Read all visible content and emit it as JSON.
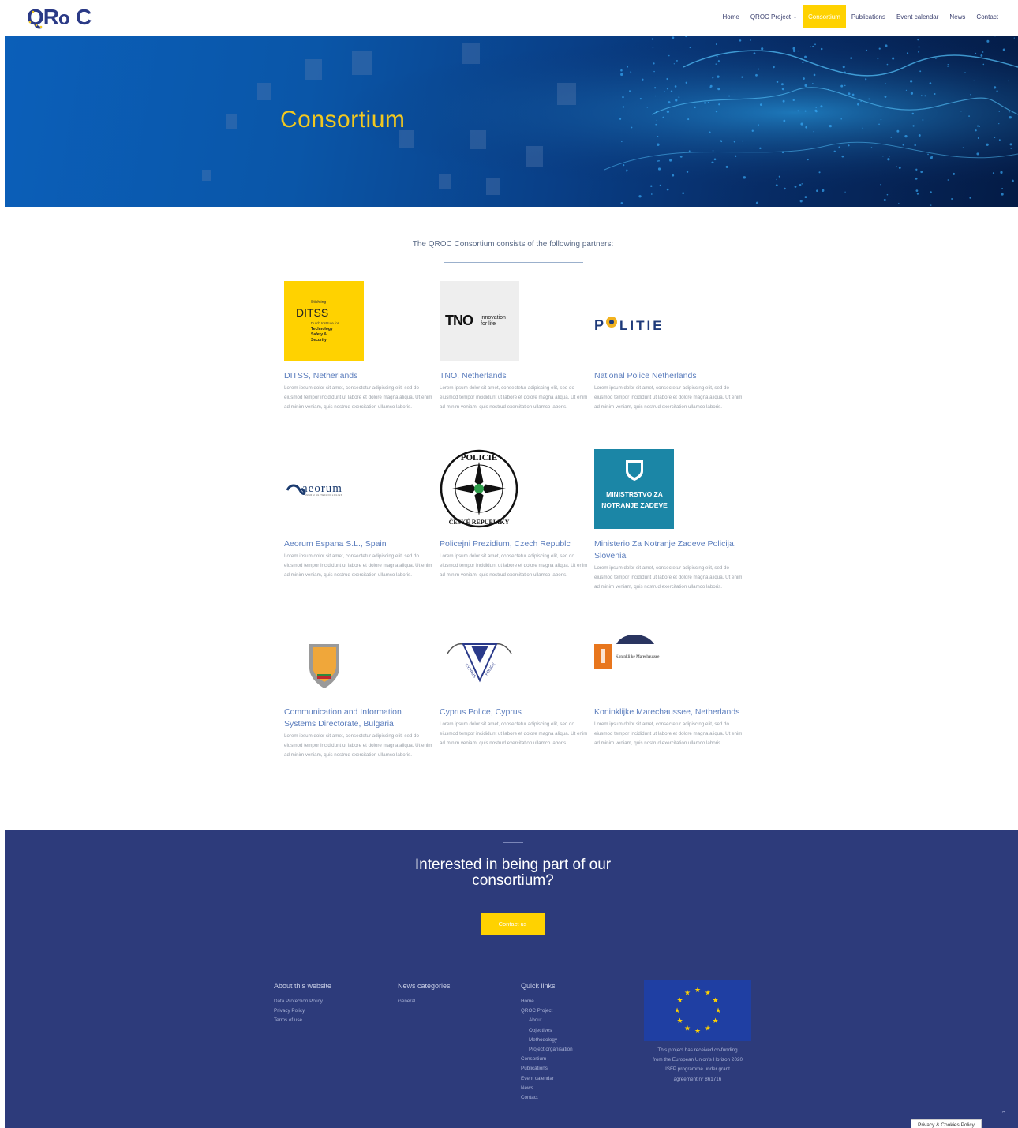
{
  "header": {
    "logo_text": "QRoC",
    "nav": [
      {
        "label": "Home",
        "active": false
      },
      {
        "label": "QROC Project",
        "active": false,
        "has_dropdown": true
      },
      {
        "label": "Consortium",
        "active": true
      },
      {
        "label": "Publications",
        "active": false
      },
      {
        "label": "Event calendar",
        "active": false
      },
      {
        "label": "News",
        "active": false
      },
      {
        "label": "Contact",
        "active": false
      }
    ]
  },
  "hero": {
    "title": "Consortium"
  },
  "intro": {
    "text": "The QROC Consortium consists of the following partners:"
  },
  "partners": [
    {
      "name": "DITSS, Netherlands",
      "logo": "ditss-logo",
      "logo_text": [
        "Stichting",
        "DITSS",
        "Dutch Institute for",
        "Technology",
        "Safety &",
        "Security"
      ]
    },
    {
      "name": "TNO, Netherlands",
      "logo": "tno-logo",
      "logo_text": [
        "TNO",
        "innovation",
        "for life"
      ]
    },
    {
      "name": "National Police Netherlands",
      "logo": "politie-logo",
      "logo_text": [
        "P",
        "LITIE"
      ]
    },
    {
      "name": "Aeorum Espana S.L., Spain",
      "logo": "aeorum-logo",
      "logo_text": [
        "aeorum",
        "EMERGING TECHNOLOGIES"
      ]
    },
    {
      "name": "Policejni Prezidium, Czech Republc",
      "logo": "policie-cr-logo",
      "logo_text": [
        "POLICIE",
        "ČESKÉ REPUBLIKY"
      ]
    },
    {
      "name": "Ministerio Za Notranje Zadeve Policija, Slovenia",
      "logo": "mnz-logo",
      "logo_text": [
        "MINISTRSTVO ZA",
        "NOTRANJE ZADEVE"
      ]
    },
    {
      "name": "Communication and Information Systems Directorate, Bulgaria",
      "logo": "cisd-logo"
    },
    {
      "name": "Cyprus Police, Cyprus",
      "logo": "cyprus-police-logo",
      "logo_text": [
        "CYPRUS",
        "POLICE"
      ]
    },
    {
      "name": "Koninklijke Marechaussee, Netherlands",
      "logo": "kmar-logo",
      "logo_text": [
        "Koninklijke Marechaussee"
      ]
    }
  ],
  "partner_desc": "Lorem ipsum dolor sit amet, consectetur adipiscing elit, sed do eiusmod tempor incididunt ut labore et dolore magna aliqua. Ut enim ad minim veniam, quis nostrud exercitation ullamco laboris.",
  "cta": {
    "title_line1": "Interested in being part of our",
    "title_line2": "consortium?",
    "button": "Contact us"
  },
  "footer": {
    "about": {
      "title": "About this website",
      "links": [
        "Data Protection Policy",
        "Privacy Policy",
        "Terms of use"
      ]
    },
    "news": {
      "title": "News categories",
      "links": [
        "General"
      ]
    },
    "quick": {
      "title": "Quick links",
      "links": [
        {
          "label": "Home",
          "sub": false
        },
        {
          "label": "QROC Project",
          "sub": false
        },
        {
          "label": "About",
          "sub": true
        },
        {
          "label": "Objectives",
          "sub": true
        },
        {
          "label": "Methodology",
          "sub": true
        },
        {
          "label": "Project organisation",
          "sub": true
        },
        {
          "label": "Consortium",
          "sub": false
        },
        {
          "label": "Publications",
          "sub": false
        },
        {
          "label": "Event calendar",
          "sub": false
        },
        {
          "label": "News",
          "sub": false
        },
        {
          "label": "Contact",
          "sub": false
        }
      ]
    },
    "eu_text": [
      "This project has received co-funding",
      "from the European Union's Horizon 2020",
      "ISFP programme under grant",
      "agreement n° 861716"
    ]
  },
  "privacy_badge": "Privacy & Cookies Policy",
  "colors": {
    "accent": "#ffd200",
    "footer_bg": "#2d3b7b",
    "link_blue": "#5b7dbd",
    "hero_title": "#f2c81f"
  }
}
